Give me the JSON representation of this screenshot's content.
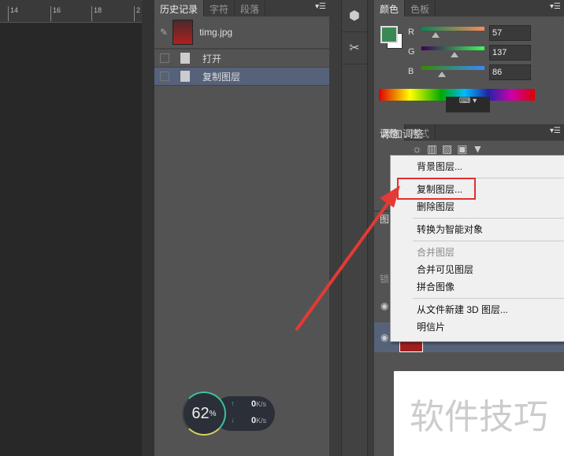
{
  "ruler": {
    "ticks": [
      "14",
      "16",
      "18",
      "2"
    ]
  },
  "history": {
    "tabs": [
      "历史记录",
      "字符",
      "段落"
    ],
    "snapshot": "timg.jpg",
    "items": [
      "打开",
      "复制图层"
    ]
  },
  "color": {
    "tabs": [
      "颜色",
      "色板"
    ],
    "channels": [
      {
        "label": "R",
        "value": "57"
      },
      {
        "label": "G",
        "value": "137"
      },
      {
        "label": "B",
        "value": "86"
      }
    ],
    "fg": "#398956"
  },
  "adjust": {
    "tabs": [
      "调整",
      "样式"
    ],
    "title": "添加调整"
  },
  "layers": {
    "tab": "图",
    "lock": "锁"
  },
  "menu": {
    "items": [
      "背景图层...",
      "复制图层...",
      "删除图层",
      "转换为智能对象",
      "合并图层",
      "合并可见图层",
      "拼合图像",
      "从文件新建 3D 图层...",
      "明信片"
    ]
  },
  "net": {
    "percent": "62",
    "unit": "%",
    "up": "0",
    "down": "0",
    "rate_unit": "K/s"
  },
  "watermark": "软件技巧"
}
